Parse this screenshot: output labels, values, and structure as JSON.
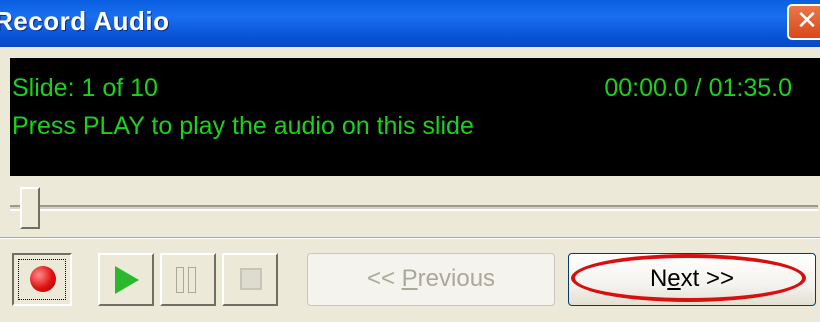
{
  "window": {
    "title": "Record Audio",
    "close_glyph": "✕"
  },
  "display": {
    "slide_label": "Slide: 1 of 10",
    "time_readout": "00:00.0 / 01:35.0",
    "message": "Press PLAY to play the audio on this slide",
    "text_color": "#1cd11c",
    "background": "#000000"
  },
  "seek": {
    "position": 0
  },
  "toolbar": {
    "record_icon": "record-icon",
    "play_icon": "play-icon",
    "pause_icon": "pause-icon",
    "stop_icon": "stop-icon"
  },
  "nav": {
    "previous_prefix": "<< ",
    "previous_accel": "P",
    "previous_rest": "revious",
    "next_prefix": "N",
    "next_accel": "e",
    "next_rest": "xt >>"
  },
  "annotation": {
    "highlight_color": "#d80f0f"
  }
}
